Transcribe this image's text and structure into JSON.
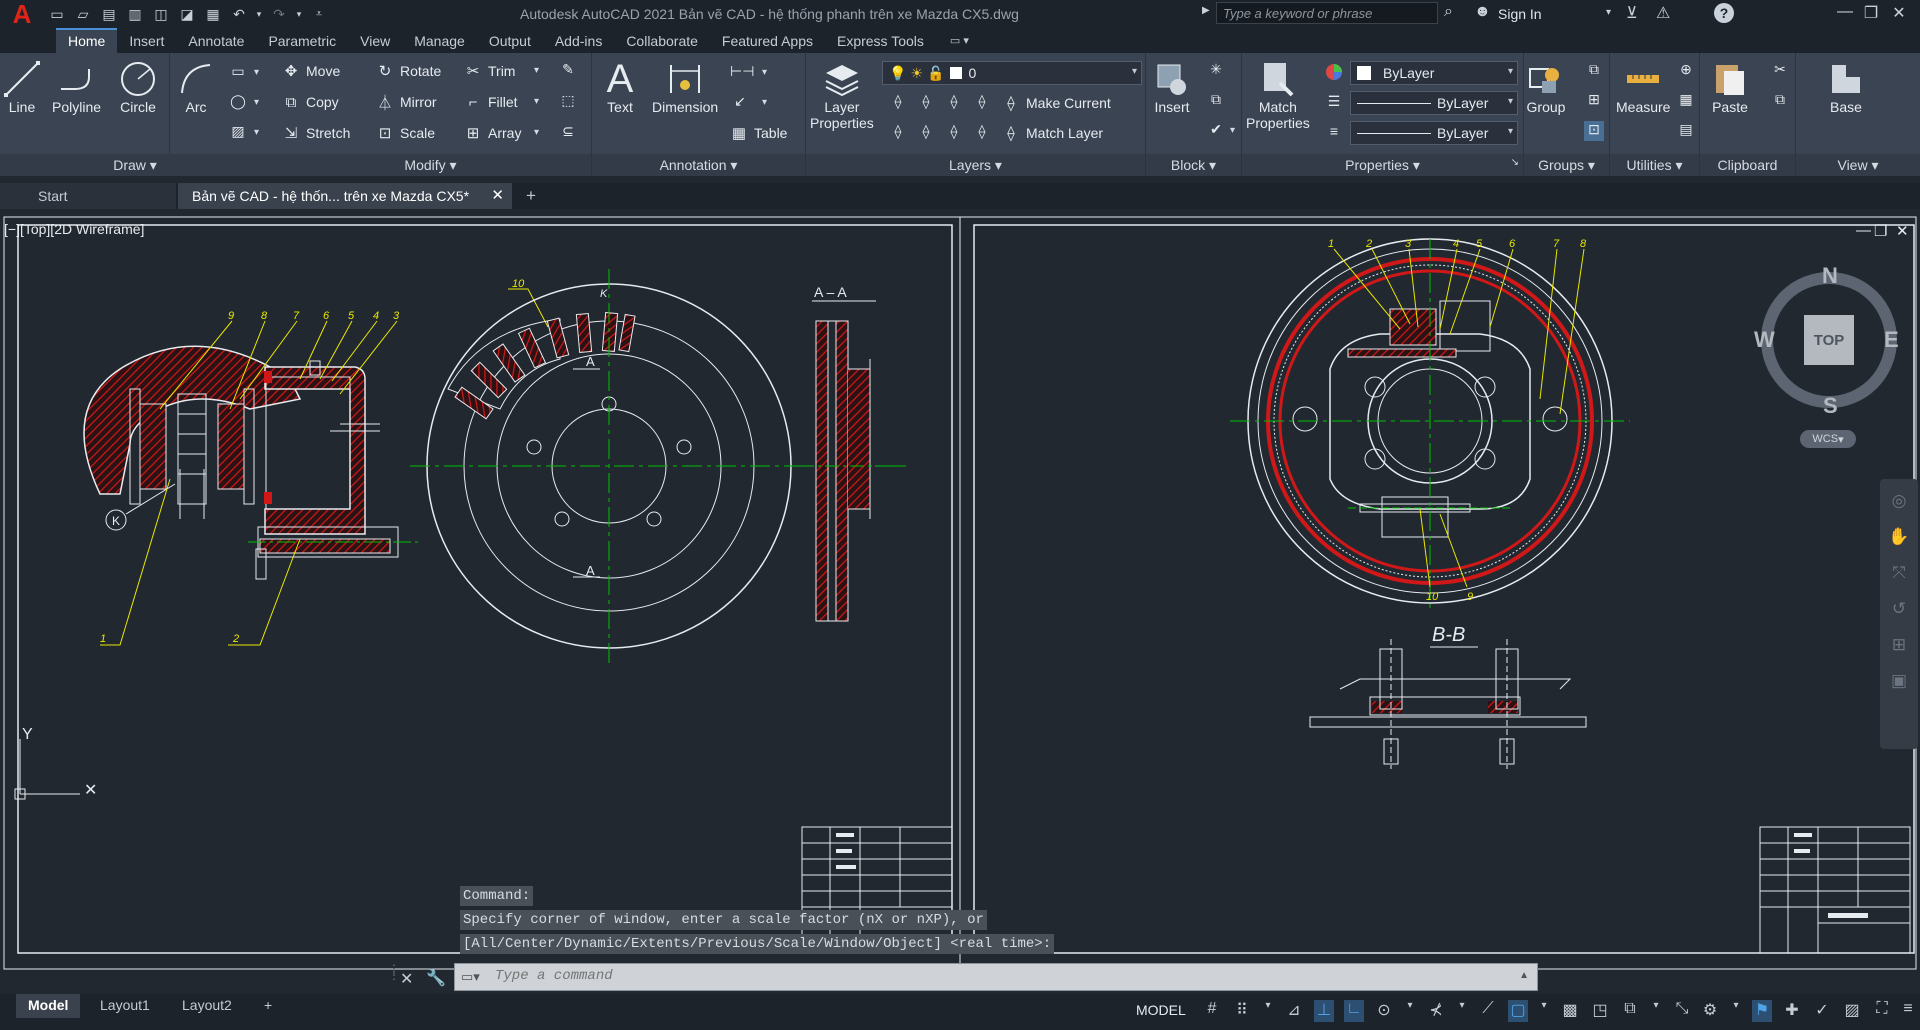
{
  "app": {
    "title": "Autodesk AutoCAD 2021    Bản vẽ CAD - hệ thống phanh trên xe Mazda CX5.dwg",
    "logo": "A",
    "search_placeholder": "Type a keyword or phrase",
    "sign_in": "Sign In"
  },
  "ribbon_tabs": [
    "Home",
    "Insert",
    "Annotate",
    "Parametric",
    "View",
    "Manage",
    "Output",
    "Add-ins",
    "Collaborate",
    "Featured Apps",
    "Express Tools"
  ],
  "active_tab": "Home",
  "panels": {
    "draw": {
      "title": "Draw",
      "line": "Line",
      "polyline": "Polyline",
      "circle": "Circle",
      "arc": "Arc"
    },
    "modify": {
      "title": "Modify",
      "move": "Move",
      "rotate": "Rotate",
      "trim": "Trim",
      "copy": "Copy",
      "mirror": "Mirror",
      "fillet": "Fillet",
      "stretch": "Stretch",
      "scale": "Scale",
      "array": "Array"
    },
    "annotation": {
      "title": "Annotation",
      "text": "Text",
      "dimension": "Dimension",
      "table": "Table"
    },
    "layers": {
      "title": "Layers",
      "layer_properties_1": "Layer",
      "layer_properties_2": "Properties",
      "current_layer": "0",
      "make_current": "Make Current",
      "match_layer": "Match Layer"
    },
    "block": {
      "title": "Block",
      "insert": "Insert"
    },
    "properties": {
      "title": "Properties",
      "match_1": "Match",
      "match_2": "Properties",
      "color": "ByLayer",
      "linetype": "ByLayer",
      "lineweight": "ByLayer"
    },
    "groups": {
      "title": "Groups",
      "group": "Group"
    },
    "utilities": {
      "title": "Utilities",
      "measure": "Measure"
    },
    "clipboard": {
      "title": "Clipboard",
      "paste": "Paste"
    },
    "view": {
      "title": "View",
      "base": "Base"
    }
  },
  "file_tabs": {
    "start": "Start",
    "document": "Bản vẽ CAD - hệ thốn... trên xe Mazda CX5*"
  },
  "viewport": {
    "label": "[−][Top][2D Wireframe]"
  },
  "viewcube": {
    "top": "TOP",
    "north": "N",
    "south": "S",
    "east": "E",
    "west": "W",
    "wcs": "WCS"
  },
  "drawing": {
    "section_aa": "A  –  A",
    "section_bb": "B-B",
    "mark_a": "A",
    "mark_k": "K",
    "left_callouts": [
      "9",
      "8",
      "7",
      "6",
      "5",
      "4",
      "3"
    ],
    "left_bottom_callouts": [
      "1",
      "2"
    ],
    "disc_callout": "10",
    "right_callouts": [
      "1",
      "2",
      "3",
      "4",
      "5",
      "6",
      "7",
      "8"
    ],
    "right_bottom_callouts": [
      "10",
      "9"
    ],
    "ucs_y": "Y"
  },
  "command": {
    "history": [
      "Command:",
      "Specify corner of window, enter a scale factor (nX or nXP), or",
      "[All/Center/Dynamic/Extents/Previous/Scale/Window/Object] <real time>:"
    ],
    "placeholder": "Type a command"
  },
  "status": {
    "layout_tabs": [
      "Model",
      "Layout1",
      "Layout2"
    ],
    "active_layout": "Model",
    "mode": "MODEL"
  },
  "colors": {
    "accent": "#4a90d9",
    "hatch": "#d01818",
    "callout": "#e8e800",
    "centerline": "#00c000"
  }
}
